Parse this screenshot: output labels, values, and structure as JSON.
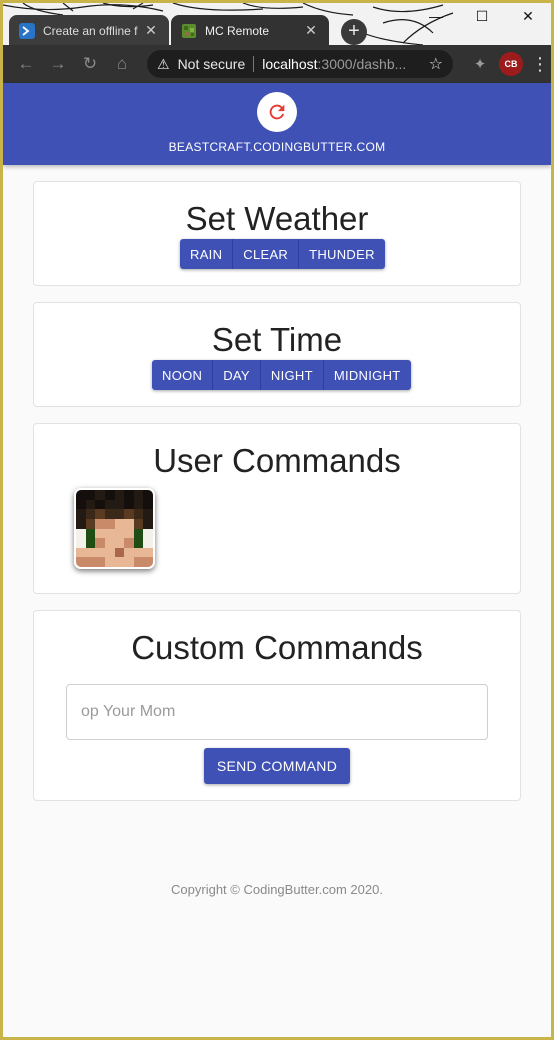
{
  "browser": {
    "tabs": [
      {
        "title": "Create an offline f",
        "active": false,
        "close": "✕"
      },
      {
        "title": "MC Remote",
        "active": true,
        "close": "✕"
      }
    ],
    "new_tab": "+",
    "window_controls": {
      "minimize": "—",
      "maximize": "☐",
      "close": "✕"
    },
    "nav": {
      "back": "←",
      "forward": "→",
      "reload": "↻",
      "home": "⌂"
    },
    "omnibox": {
      "security_warning": "⚠",
      "security_label": "Not secure",
      "host": "localhost",
      "path": ":3000/dashb...",
      "bookmark": "☆"
    },
    "extensions": "✦",
    "profile_label": "CB",
    "menu": "⋮"
  },
  "header": {
    "refresh_icon": "refresh-icon",
    "refresh_color": "#e53935",
    "title": "BEASTCRAFT.CODINGBUTTER.COM",
    "color": "#3f51b5"
  },
  "weather": {
    "title": "Set Weather",
    "buttons": [
      "RAIN",
      "CLEAR",
      "THUNDER"
    ]
  },
  "time": {
    "title": "Set Time",
    "buttons": [
      "NOON",
      "DAY",
      "NIGHT",
      "MIDNIGHT"
    ]
  },
  "users": {
    "title": "User Commands",
    "avatar": "player-head-avatar"
  },
  "custom": {
    "title": "Custom Commands",
    "input_value": "",
    "input_placeholder": "op Your Mom",
    "send_label": "SEND COMMAND"
  },
  "footer": {
    "text": "Copyright © CodingButter.com 2020."
  }
}
